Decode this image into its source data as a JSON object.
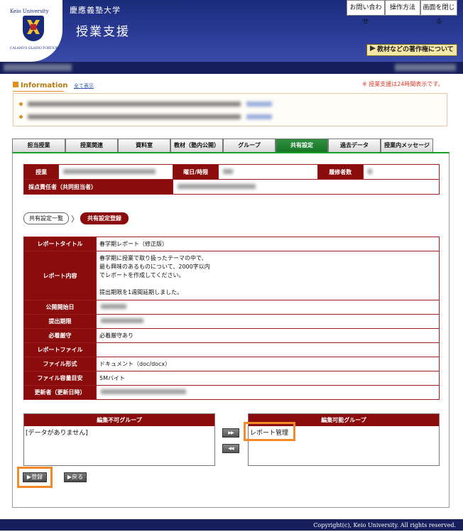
{
  "header": {
    "university_en": "Keio University",
    "university_jp": "慶應義塾大学",
    "app_title": "授業支援",
    "logo_motto": "CALAMUS GLADIO FORTIOR",
    "top_buttons": [
      "お問い合わせ",
      "操作方法",
      "画面を閉じる"
    ],
    "copyright_link": "教材などの著作権について"
  },
  "info": {
    "label": "Information",
    "show_all": "全て表示",
    "note": "※ 授業支援は24時間表示です。"
  },
  "tabs": [
    "担当授業",
    "授業関連",
    "資料室",
    "教材（塾内公開）",
    "グループ",
    "共有設定",
    "過去データ",
    "授業内メッセージ"
  ],
  "active_tab": 5,
  "course": {
    "course_label": "授業",
    "day_label": "曜日/時限",
    "students_label": "履修者数",
    "grader_label": "採点責任者（共同担当者）"
  },
  "breadcrumb": {
    "list": "共有設定一覧",
    "current": "共有設定登録"
  },
  "report": {
    "rows": [
      {
        "label": "レポートタイトル",
        "value": "春学期レポート（修正版）"
      },
      {
        "label": "レポート内容",
        "value": "春学期に授業で取り扱ったテーマの中で、\n最も興味のあるものについて、2000字以内\nでレポートを作成してください。\n\n提出期限を1週間延期しました。"
      },
      {
        "label": "公開開始日",
        "value": ""
      },
      {
        "label": "提出期限",
        "value": ""
      },
      {
        "label": "必着厳守",
        "value": "必着厳守あり"
      },
      {
        "label": "レポートファイル",
        "value": ""
      },
      {
        "label": "ファイル形式",
        "value": "ドキュメント（doc/docx）"
      },
      {
        "label": "ファイル容量目安",
        "value": "5Mバイト"
      },
      {
        "label": "更新者（更新日時）",
        "value": ""
      }
    ]
  },
  "groups": {
    "non_editable_title": "編集不可グループ",
    "non_editable_empty": "[データがありません]",
    "editable_title": "編集可能グループ",
    "editable_item": "レポート管理",
    "move_right": "▶▶",
    "move_left": "◀◀"
  },
  "buttons": {
    "register": "▶登録",
    "back": "▶戻る"
  },
  "footer": {
    "copyright": "Copyright(c), Keio University. All rights reserved."
  },
  "colors": {
    "header": "#2d3d99",
    "maroon": "#8a0c0c",
    "active_tab": "#177626",
    "highlight": "#f28a2a"
  }
}
